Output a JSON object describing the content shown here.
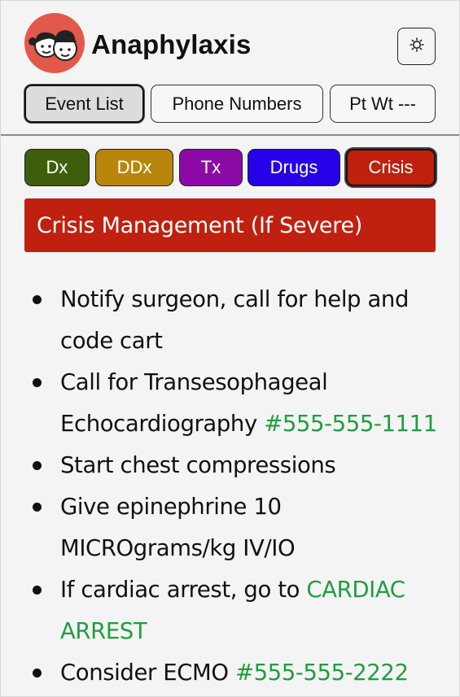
{
  "app": {
    "title": "Anaphylaxis"
  },
  "colors": {
    "logo_bg": "#e2584a",
    "dx": "#3f5e0b",
    "ddx": "#b8860b",
    "tx": "#8b0aa5",
    "drugs": "#2600e6",
    "crisis": "#c0200f",
    "link": "#1f9e3f"
  },
  "icons": {
    "logo": "two-faces-logo",
    "settings": "gear-icon"
  },
  "nav": {
    "items": [
      {
        "label": "Event List",
        "active": true
      },
      {
        "label": "Phone Numbers",
        "active": false
      },
      {
        "label": "Pt Wt ---",
        "active": false
      }
    ]
  },
  "tabs": [
    {
      "label": "Dx",
      "active": false
    },
    {
      "label": "DDx",
      "active": false
    },
    {
      "label": "Tx",
      "active": false
    },
    {
      "label": "Drugs",
      "active": false
    },
    {
      "label": "Crisis",
      "active": true
    }
  ],
  "section": {
    "title": "Crisis Management (If Severe)"
  },
  "items": [
    {
      "text": "Notify surgeon, call for help and code cart",
      "link": ""
    },
    {
      "text": "Call for Transesophageal Echocardiography ",
      "link": "#555-555-1111"
    },
    {
      "text": "Start chest compressions",
      "link": ""
    },
    {
      "text": "Give epinephrine 10 MICROgrams/kg IV/IO",
      "link": ""
    },
    {
      "text": "If cardiac arrest, go to ",
      "link": "CARDIAC ARREST"
    },
    {
      "text": "Consider ECMO ",
      "link": "#555-555-2222"
    }
  ]
}
